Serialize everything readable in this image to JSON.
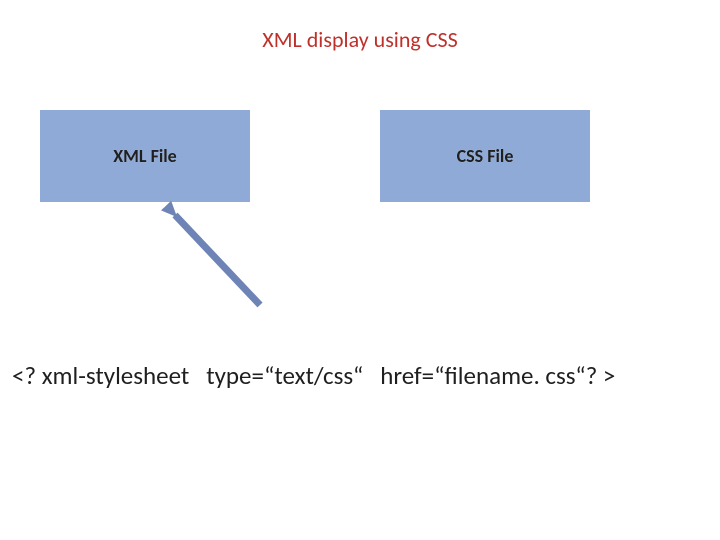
{
  "title": "XML display using CSS",
  "boxes": {
    "xml": "XML File",
    "css": "CSS File"
  },
  "code": "<? xml-stylesheet   type=“text/css“   href=“filename. css“? >",
  "colors": {
    "title": "#c0302a",
    "box_fill": "#8faad6",
    "arrow": "#6e84b6"
  }
}
